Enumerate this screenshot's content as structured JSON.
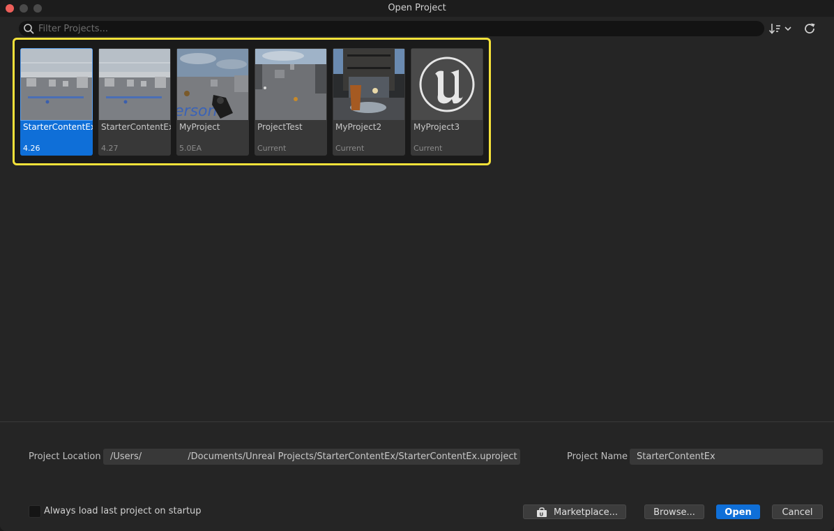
{
  "window": {
    "title": "Open Project"
  },
  "search": {
    "placeholder": "Filter Projects..."
  },
  "toolbar": {
    "sort_icon": "sort-icon",
    "refresh_icon": "refresh-icon"
  },
  "projects": [
    {
      "name": "StarterContentEx",
      "version": "4.26",
      "selected": true
    },
    {
      "name": "StarterContentEx",
      "version": "4.27",
      "selected": false
    },
    {
      "name": "MyProject",
      "version": "5.0EA",
      "selected": false
    },
    {
      "name": "ProjectTest",
      "version": "Current",
      "selected": false
    },
    {
      "name": "MyProject2",
      "version": "Current",
      "selected": false
    },
    {
      "name": "MyProject3",
      "version": "Current",
      "selected": false
    }
  ],
  "details": {
    "location_label": "Project Location",
    "location_value": "/Users/                /Documents/Unreal Projects/StarterContentEx/StarterContentEx.uproject",
    "name_label": "Project Name",
    "name_value": "StarterContentEx"
  },
  "footer": {
    "checkbox_label": "Always load last project on startup",
    "checkbox_checked": false,
    "marketplace_label": "Marketplace...",
    "browse_label": "Browse...",
    "open_label": "Open",
    "cancel_label": "Cancel"
  },
  "colors": {
    "accent": "#0f6fd8",
    "highlight": "#f5e23a",
    "close": "#ed5f5a"
  }
}
